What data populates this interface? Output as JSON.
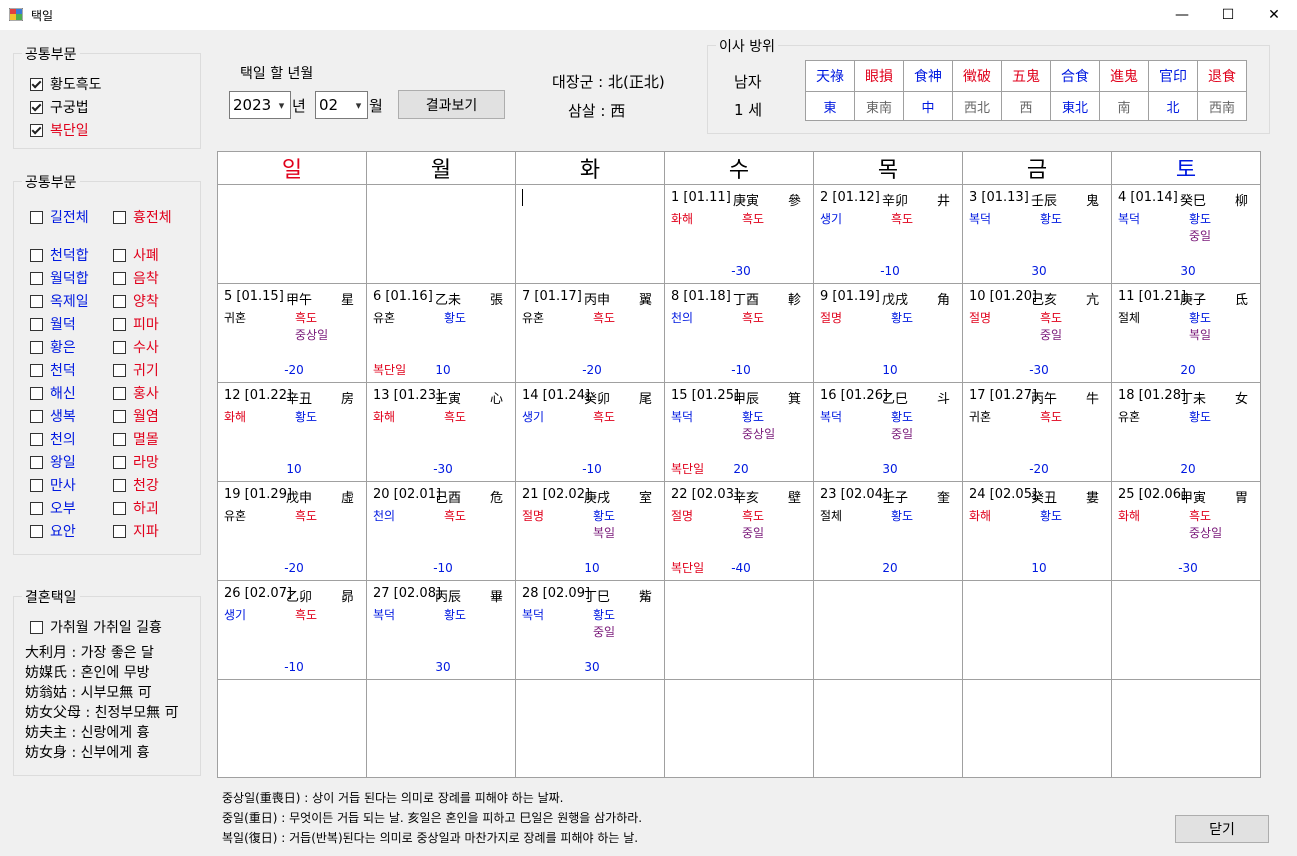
{
  "window": {
    "title": "택일",
    "minimize": "—",
    "maximize": "☐",
    "close": "✕"
  },
  "common1": {
    "legend": "공통부문",
    "items": [
      {
        "label": "황도흑도",
        "checked": true,
        "color": "#000000"
      },
      {
        "label": "구궁법",
        "checked": true,
        "color": "#000000"
      },
      {
        "label": "복단일",
        "checked": true,
        "color": "#e0001b"
      }
    ]
  },
  "common2": {
    "legend": "공통부문",
    "left": [
      "길전체",
      "천덕합",
      "월덕합",
      "옥제일",
      "월덕",
      "황은",
      "천덕",
      "해신",
      "생복",
      "천의",
      "왕일",
      "만사",
      "오부",
      "요안"
    ],
    "right": [
      "흉전체",
      "사폐",
      "음착",
      "양착",
      "피마",
      "수사",
      "귀기",
      "홍사",
      "월염",
      "멸몰",
      "라망",
      "천강",
      "하괴",
      "지파"
    ]
  },
  "marriage": {
    "legend": "결혼택일",
    "checkbox": "가취월 가취일 길흉",
    "lines": [
      "大利月 : 가장 좋은 달",
      "妨媒氏 : 혼인에 무방",
      "妨翁姑 : 시부모無 可",
      "妨女父母 : 친정부모無 可",
      "妨夫主 : 신랑에게 흉",
      "妨女身 : 신부에게 흉"
    ]
  },
  "selector": {
    "label": "택일 할 년월",
    "year": "2023",
    "year_unit": "년",
    "month": "02",
    "month_unit": "월",
    "button": "결과보기"
  },
  "info": {
    "daejanggun": "대장군 : 北(正北)",
    "samsal": "삼살 : 西"
  },
  "move": {
    "legend": "이사 방위",
    "gender": "남자",
    "age": "1 세",
    "headers": [
      {
        "t": "天祿",
        "c": "#0019e0"
      },
      {
        "t": "眼損",
        "c": "#e0001b"
      },
      {
        "t": "食神",
        "c": "#0019e0"
      },
      {
        "t": "徵破",
        "c": "#e0001b"
      },
      {
        "t": "五鬼",
        "c": "#e0001b"
      },
      {
        "t": "合食",
        "c": "#0019e0"
      },
      {
        "t": "進鬼",
        "c": "#e0001b"
      },
      {
        "t": "官印",
        "c": "#0019e0"
      },
      {
        "t": "退食",
        "c": "#e0001b"
      }
    ],
    "values": [
      {
        "t": "東",
        "c": "#0019e0"
      },
      {
        "t": "東南",
        "c": "#666666"
      },
      {
        "t": "中",
        "c": "#0019e0"
      },
      {
        "t": "西北",
        "c": "#666666"
      },
      {
        "t": "西",
        "c": "#666666"
      },
      {
        "t": "東北",
        "c": "#0019e0"
      },
      {
        "t": "南",
        "c": "#666666"
      },
      {
        "t": "北",
        "c": "#0019e0"
      },
      {
        "t": "西南",
        "c": "#666666"
      }
    ]
  },
  "calendar": {
    "weekdays": [
      {
        "t": "일",
        "c": "#e0001b"
      },
      {
        "t": "월",
        "c": "#000000"
      },
      {
        "t": "화",
        "c": "#000000"
      },
      {
        "t": "수",
        "c": "#000000"
      },
      {
        "t": "목",
        "c": "#000000"
      },
      {
        "t": "금",
        "c": "#000000"
      },
      {
        "t": "토",
        "c": "#0019e0"
      }
    ],
    "days": [
      {
        "n": "1 [01.11]",
        "g": "庚寅",
        "s": "參",
        "e1": "화해",
        "e1c": "red",
        "e2": "흑도",
        "e2c": "red",
        "score": "-30"
      },
      {
        "n": "2 [01.12]",
        "g": "辛卯",
        "s": "井",
        "e1": "생기",
        "e1c": "blue",
        "e2": "흑도",
        "e2c": "red",
        "score": "-10"
      },
      {
        "n": "3 [01.13]",
        "g": "壬辰",
        "s": "鬼",
        "e1": "복덕",
        "e1c": "blue",
        "e2": "황도",
        "e2c": "blue",
        "score": "30"
      },
      {
        "n": "4 [01.14]",
        "g": "癸巳",
        "s": "柳",
        "e1": "복덕",
        "e1c": "blue",
        "e2": "황도",
        "e2c": "blue",
        "e3": "중일",
        "score": "30"
      },
      {
        "n": "5 [01.15]",
        "g": "甲午",
        "s": "星",
        "e1": "귀혼",
        "e1c": "black",
        "e2": "흑도",
        "e2c": "red",
        "e3": "중상일",
        "score": "-20"
      },
      {
        "n": "6 [01.16]",
        "g": "乙未",
        "s": "張",
        "e1": "유혼",
        "e1c": "black",
        "e2": "황도",
        "e2c": "blue",
        "e4": "복단일",
        "score": "10"
      },
      {
        "n": "7 [01.17]",
        "g": "丙申",
        "s": "翼",
        "e1": "유혼",
        "e1c": "black",
        "e2": "흑도",
        "e2c": "red",
        "score": "-20"
      },
      {
        "n": "8 [01.18]",
        "g": "丁酉",
        "s": "軫",
        "e1": "천의",
        "e1c": "blue",
        "e2": "흑도",
        "e2c": "red",
        "score": "-10"
      },
      {
        "n": "9 [01.19]",
        "g": "戊戌",
        "s": "角",
        "e1": "절명",
        "e1c": "red",
        "e2": "황도",
        "e2c": "blue",
        "score": "10"
      },
      {
        "n": "10 [01.20]",
        "g": "己亥",
        "s": "亢",
        "e1": "절명",
        "e1c": "red",
        "e2": "흑도",
        "e2c": "red",
        "e3": "중일",
        "score": "-30"
      },
      {
        "n": "11 [01.21]",
        "g": "庚子",
        "s": "氐",
        "e1": "절체",
        "e1c": "black",
        "e2": "황도",
        "e2c": "blue",
        "e3": "복일",
        "score": "20"
      },
      {
        "n": "12 [01.22]",
        "g": "辛丑",
        "s": "房",
        "e1": "화해",
        "e1c": "red",
        "e2": "황도",
        "e2c": "blue",
        "score": "10"
      },
      {
        "n": "13 [01.23]",
        "g": "壬寅",
        "s": "心",
        "e1": "화해",
        "e1c": "red",
        "e2": "흑도",
        "e2c": "red",
        "score": "-30"
      },
      {
        "n": "14 [01.24]",
        "g": "癸卯",
        "s": "尾",
        "e1": "생기",
        "e1c": "blue",
        "e2": "흑도",
        "e2c": "red",
        "score": "-10"
      },
      {
        "n": "15 [01.25]",
        "g": "甲辰",
        "s": "箕",
        "e1": "복덕",
        "e1c": "blue",
        "e2": "황도",
        "e2c": "blue",
        "e3": "중상일",
        "e4": "복단일",
        "score": "20"
      },
      {
        "n": "16 [01.26]",
        "g": "乙巳",
        "s": "斗",
        "e1": "복덕",
        "e1c": "blue",
        "e2": "황도",
        "e2c": "blue",
        "e3": "중일",
        "score": "30"
      },
      {
        "n": "17 [01.27]",
        "g": "丙午",
        "s": "牛",
        "e1": "귀혼",
        "e1c": "black",
        "e2": "흑도",
        "e2c": "red",
        "score": "-20"
      },
      {
        "n": "18 [01.28]",
        "g": "丁未",
        "s": "女",
        "e1": "유혼",
        "e1c": "black",
        "e2": "황도",
        "e2c": "blue",
        "score": "20"
      },
      {
        "n": "19 [01.29]",
        "g": "戊申",
        "s": "虛",
        "e1": "유혼",
        "e1c": "black",
        "e2": "흑도",
        "e2c": "red",
        "score": "-20"
      },
      {
        "n": "20 [02.01]",
        "g": "己酉",
        "s": "危",
        "e1": "천의",
        "e1c": "blue",
        "e2": "흑도",
        "e2c": "red",
        "score": "-10"
      },
      {
        "n": "21 [02.02]",
        "g": "庚戌",
        "s": "室",
        "e1": "절명",
        "e1c": "red",
        "e2": "황도",
        "e2c": "blue",
        "e3": "복일",
        "score": "10"
      },
      {
        "n": "22 [02.03]",
        "g": "辛亥",
        "s": "壁",
        "e1": "절명",
        "e1c": "red",
        "e2": "흑도",
        "e2c": "red",
        "e3": "중일",
        "e4": "복단일",
        "score": "-40"
      },
      {
        "n": "23 [02.04]",
        "g": "壬子",
        "s": "奎",
        "e1": "절체",
        "e1c": "black",
        "e2": "황도",
        "e2c": "blue",
        "score": "20"
      },
      {
        "n": "24 [02.05]",
        "g": "癸丑",
        "s": "婁",
        "e1": "화해",
        "e1c": "red",
        "e2": "황도",
        "e2c": "blue",
        "score": "10"
      },
      {
        "n": "25 [02.06]",
        "g": "甲寅",
        "s": "胃",
        "e1": "화해",
        "e1c": "red",
        "e2": "흑도",
        "e2c": "red",
        "e3": "중상일",
        "score": "-30"
      },
      {
        "n": "26 [02.07]",
        "g": "乙卯",
        "s": "昴",
        "e1": "생기",
        "e1c": "blue",
        "e2": "흑도",
        "e2c": "red",
        "score": "-10"
      },
      {
        "n": "27 [02.08]",
        "g": "丙辰",
        "s": "畢",
        "e1": "복덕",
        "e1c": "blue",
        "e2": "황도",
        "e2c": "blue",
        "score": "30"
      },
      {
        "n": "28 [02.09]",
        "g": "丁巳",
        "s": "觜",
        "e1": "복덕",
        "e1c": "blue",
        "e2": "황도",
        "e2c": "blue",
        "e3": "중일",
        "score": "30"
      }
    ],
    "first_weekday": 3
  },
  "notes": [
    "중상일(重喪日) : 상이 거듭 된다는 의미로 장례를 피해야 하는 날짜.",
    "중일(重日) : 무엇이든 거듭 되는 날. 亥일은 혼인을 피하고 巳일은 원행을 삼가하라.",
    "복일(復日) : 거듭(반복)된다는 의미로 중상일과 마찬가지로 장례를 피해야 하는 날."
  ],
  "close_button": "닫기"
}
